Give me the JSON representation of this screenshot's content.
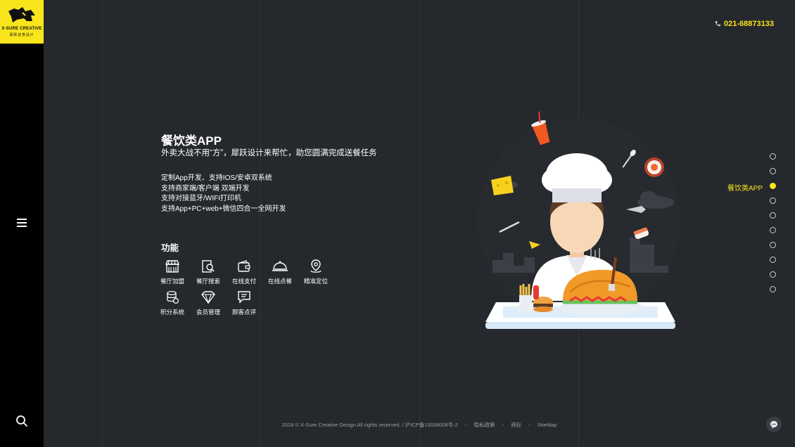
{
  "brand": {
    "name": "X-SURE CREATIVE",
    "sub": "犀跃创意设计"
  },
  "header": {
    "phone_icon": "phone-icon",
    "phone": "021-68873133"
  },
  "hero": {
    "title": "餐饮类APP",
    "subtitle": "外卖大战不用“方”，犀跃设计来帮忙，助您圆满完成送餐任务",
    "desc": [
      "定制App开发、支持IOS/安卓双系统",
      "支持商家端/客户端 双端开发",
      "支持对接蓝牙/WIFI打印机",
      "支持App+PC+web+微信四合一全网开发"
    ]
  },
  "features": {
    "title": "功能",
    "items": [
      {
        "label": "餐厅加盟",
        "icon": "storefront-icon"
      },
      {
        "label": "餐厅搜索",
        "icon": "search-document-icon"
      },
      {
        "label": "在线支付",
        "icon": "wallet-icon"
      },
      {
        "label": "在线点餐",
        "icon": "cloche-icon"
      },
      {
        "label": "精准定位",
        "icon": "location-pin-icon"
      },
      {
        "label": "积分系统",
        "icon": "coins-icon"
      },
      {
        "label": "会员管理",
        "icon": "diamond-icon"
      },
      {
        "label": "顾客点评",
        "icon": "comment-icon"
      }
    ]
  },
  "dotnav": {
    "count": 10,
    "active_index": 2,
    "active_label": "餐饮类APP"
  },
  "footer": {
    "copyright": "2018 © X-Sure Creative Design All rights reserved. / 沪ICP备15039008号-2",
    "sep": "-",
    "links": [
      "隐私政策",
      "商标",
      "SiteMap"
    ]
  },
  "colors": {
    "accent": "#f8e51c",
    "background": "#25282c",
    "rail": "#000000"
  }
}
